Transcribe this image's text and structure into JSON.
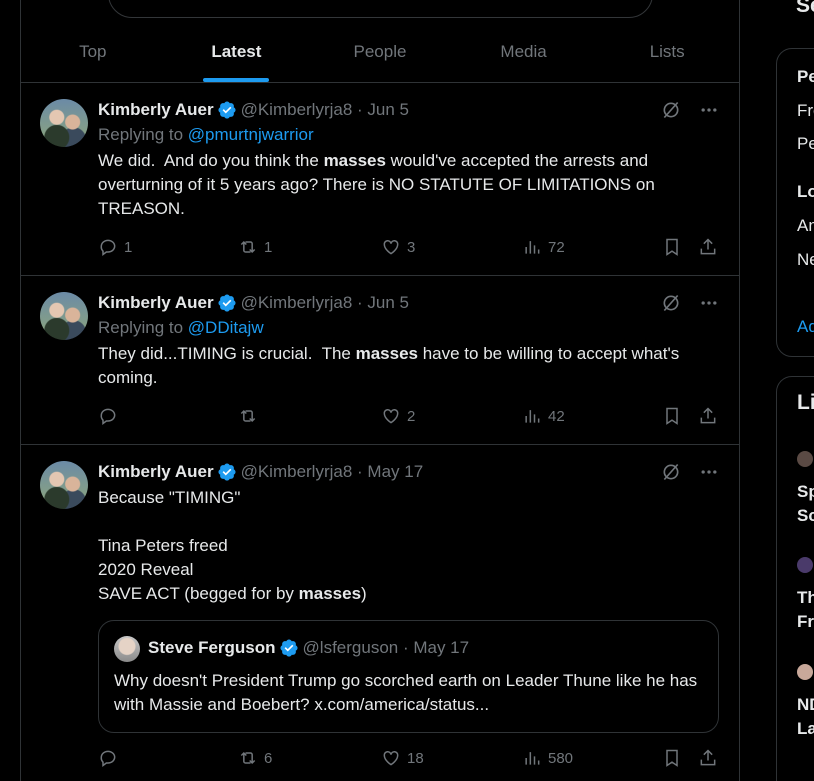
{
  "tabs": [
    {
      "label": "Top",
      "active": false
    },
    {
      "label": "Latest",
      "active": true
    },
    {
      "label": "People",
      "active": false
    },
    {
      "label": "Media",
      "active": false
    },
    {
      "label": "Lists",
      "active": false
    }
  ],
  "tweets": [
    {
      "name": "Kimberly Auer",
      "handle": "@Kimberlyrja8 · Jun 5",
      "reply_prefix": "Replying to ",
      "reply_to": "@pmurtnjwarrior",
      "text_parts": [
        "We did.  And do you think the ",
        "masses",
        " would've accepted the arrests and overturning of it 5 years ago? There is NO STATUTE OF LIMITATIONS on TREASON."
      ],
      "replies": "1",
      "reposts": "1",
      "likes": "3",
      "views": "72"
    },
    {
      "name": "Kimberly Auer",
      "handle": "@Kimberlyrja8 · Jun 5",
      "reply_prefix": "Replying to ",
      "reply_to": "@DDitajw",
      "text_parts": [
        "They did...TIMING is crucial.  The ",
        "masses",
        " have to be willing to accept what's coming."
      ],
      "replies": "",
      "reposts": "",
      "likes": "2",
      "views": "42"
    },
    {
      "name": "Kimberly Auer",
      "handle": "@Kimberlyrja8 · May 17",
      "text_parts": [
        "Because \"TIMING\"\n\nTina Peters freed\n2020 Reveal\nSAVE ACT (begged for by ",
        "masses",
        ")"
      ],
      "quote": {
        "name": "Steve Ferguson",
        "handle": "@lsferguson · May 17",
        "text": "Why doesn't President Trump go scorched earth on Leader Thune like he has with Massie and Boebert? x.com/america/status..."
      },
      "replies": "",
      "reposts": "6",
      "likes": "18",
      "views": "580"
    }
  ],
  "right_panel": {
    "section1_title": "Se",
    "box1": [
      "Pe",
      "Fro",
      "Pe",
      "Lo",
      "An",
      "Ne",
      "Ad"
    ],
    "box2_title": "Li",
    "box2": [
      "Sp",
      "Sc",
      "Th",
      "Fra",
      "ND",
      "La"
    ]
  }
}
